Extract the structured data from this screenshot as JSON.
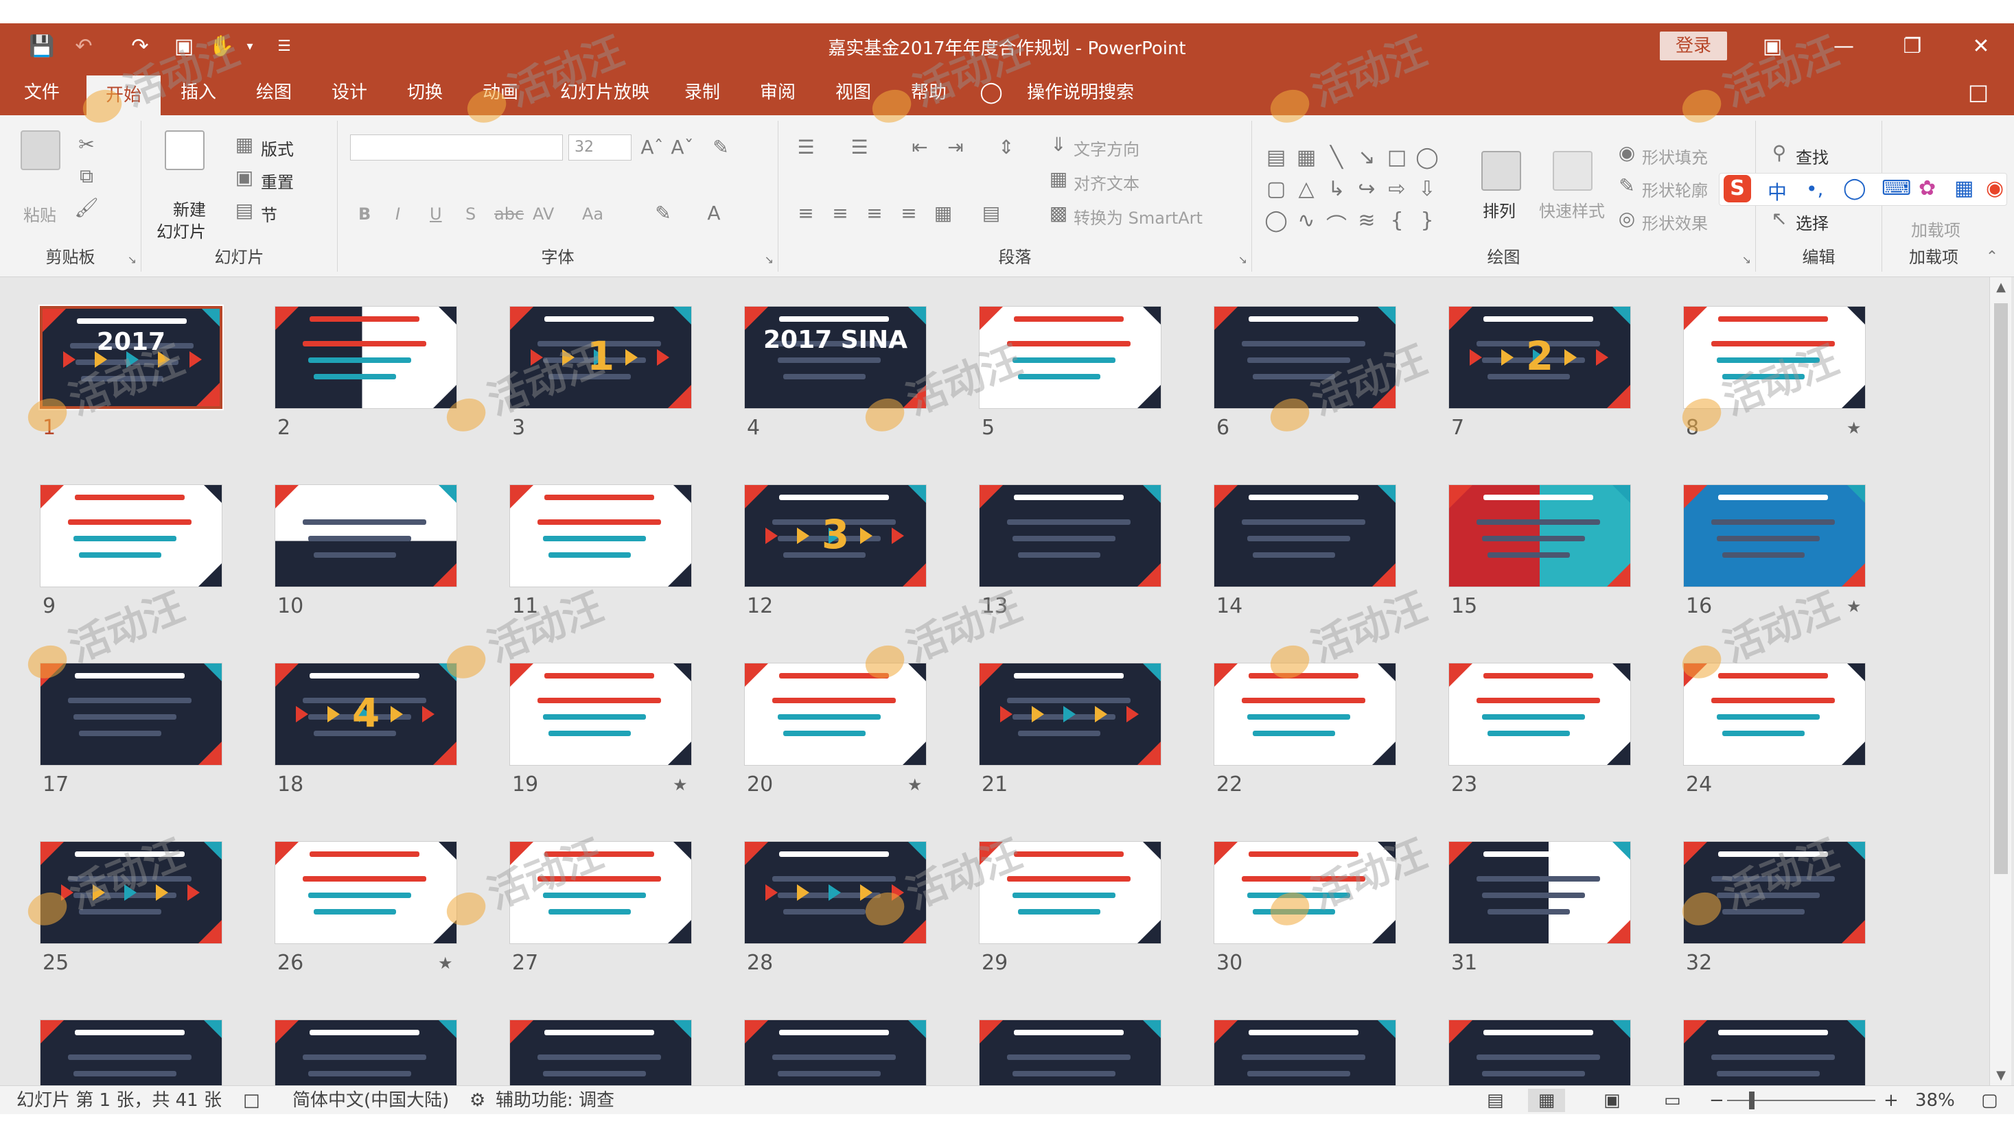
{
  "window": {
    "title": "嘉实基金2017年年度合作规划 - PowerPoint",
    "signin_label": "登录",
    "colors": {
      "accent": "#b7472a",
      "ribbon_bg": "#f3f3f3",
      "workspace_bg": "#e7e7e7"
    }
  },
  "quick_access": [
    "save-icon",
    "undo-icon",
    "redo-icon",
    "present-icon",
    "touch-mode-icon",
    "customize-icon"
  ],
  "tabs": [
    {
      "label": "文件"
    },
    {
      "label": "开始"
    },
    {
      "label": "插入"
    },
    {
      "label": "绘图"
    },
    {
      "label": "设计"
    },
    {
      "label": "切换"
    },
    {
      "label": "动画"
    },
    {
      "label": "幻灯片放映"
    },
    {
      "label": "录制"
    },
    {
      "label": "审阅"
    },
    {
      "label": "视图"
    },
    {
      "label": "帮助"
    }
  ],
  "tell_me": "操作说明搜索",
  "ribbon": {
    "clipboard": {
      "label": "剪贴板",
      "paste": "粘贴"
    },
    "slides": {
      "label": "幻灯片",
      "new_slide_1": "新建",
      "new_slide_2": "幻灯片",
      "layout": "版式",
      "reset": "重置",
      "section": "节"
    },
    "font": {
      "label": "字体",
      "size": "32",
      "bold": "B",
      "italic": "I",
      "underline": "U",
      "shadow": "S",
      "strike": "abc",
      "spacing": "AV",
      "case": "Aa"
    },
    "paragraph": {
      "label": "段落",
      "text_direction": "文字方向",
      "align_text": "对齐文本",
      "smartart": "转换为 SmartArt"
    },
    "drawing": {
      "label": "绘图",
      "arrange": "排列",
      "quick_styles": "快速样式",
      "fill": "形状填充",
      "outline": "形状轮廓",
      "effects": "形状效果"
    },
    "editing": {
      "label": "编辑",
      "find": "查找",
      "select": "选择"
    },
    "addins": {
      "label": "加载项",
      "addins": "加载项"
    }
  },
  "slides": [
    {
      "n": "1",
      "theme": "dark",
      "text": "2017",
      "starred": false,
      "selected": true
    },
    {
      "n": "2",
      "theme": "globe",
      "text": "",
      "starred": false,
      "selected": false
    },
    {
      "n": "3",
      "theme": "dark1",
      "text": "1",
      "starred": false,
      "selected": false
    },
    {
      "n": "4",
      "theme": "sina",
      "text": "2017 SINA",
      "starred": false,
      "selected": false
    },
    {
      "n": "5",
      "theme": "light",
      "text": "",
      "starred": false,
      "selected": false
    },
    {
      "n": "6",
      "theme": "dark",
      "text": "",
      "starred": false,
      "selected": false
    },
    {
      "n": "7",
      "theme": "dark2",
      "text": "2",
      "starred": false,
      "selected": false
    },
    {
      "n": "8",
      "theme": "light",
      "text": "",
      "starred": true,
      "selected": false
    },
    {
      "n": "9",
      "theme": "light",
      "text": "",
      "starred": false,
      "selected": false
    },
    {
      "n": "10",
      "theme": "teal",
      "text": "",
      "starred": false,
      "selected": false
    },
    {
      "n": "11",
      "theme": "light",
      "text": "",
      "starred": false,
      "selected": false
    },
    {
      "n": "12",
      "theme": "dark3",
      "text": "3",
      "starred": false,
      "selected": false
    },
    {
      "n": "13",
      "theme": "dark",
      "text": "",
      "starred": false,
      "selected": false
    },
    {
      "n": "14",
      "theme": "dark",
      "text": "",
      "starred": false,
      "selected": false
    },
    {
      "n": "15",
      "theme": "redcyan",
      "text": "",
      "starred": false,
      "selected": false
    },
    {
      "n": "16",
      "theme": "bluemap",
      "text": "",
      "starred": true,
      "selected": false
    },
    {
      "n": "17",
      "theme": "dark",
      "text": "",
      "starred": false,
      "selected": false
    },
    {
      "n": "18",
      "theme": "dark4",
      "text": "4",
      "starred": false,
      "selected": false
    },
    {
      "n": "19",
      "theme": "light",
      "text": "",
      "starred": true,
      "selected": false
    },
    {
      "n": "20",
      "theme": "light",
      "text": "",
      "starred": true,
      "selected": false
    },
    {
      "n": "21",
      "theme": "darkarrow",
      "text": "",
      "starred": false,
      "selected": false
    },
    {
      "n": "22",
      "theme": "light",
      "text": "",
      "starred": false,
      "selected": false
    },
    {
      "n": "23",
      "theme": "light",
      "text": "",
      "starred": false,
      "selected": false
    },
    {
      "n": "24",
      "theme": "light",
      "text": "",
      "starred": false,
      "selected": false
    },
    {
      "n": "25",
      "theme": "darkarrow",
      "text": "",
      "starred": false,
      "selected": false
    },
    {
      "n": "26",
      "theme": "light",
      "text": "",
      "starred": true,
      "selected": false
    },
    {
      "n": "27",
      "theme": "light",
      "text": "",
      "starred": false,
      "selected": false
    },
    {
      "n": "28",
      "theme": "darkarrow",
      "text": "",
      "starred": false,
      "selected": false
    },
    {
      "n": "29",
      "theme": "light",
      "text": "",
      "starred": false,
      "selected": false
    },
    {
      "n": "30",
      "theme": "light",
      "text": "",
      "starred": false,
      "selected": false
    },
    {
      "n": "31",
      "theme": "map",
      "text": "",
      "starred": false,
      "selected": false
    },
    {
      "n": "32",
      "theme": "dark",
      "text": "",
      "starred": false,
      "selected": false
    },
    {
      "n": "",
      "theme": "dark",
      "text": "",
      "starred": false,
      "selected": false
    },
    {
      "n": "",
      "theme": "dark",
      "text": "",
      "starred": false,
      "selected": false
    },
    {
      "n": "",
      "theme": "dark",
      "text": "",
      "starred": false,
      "selected": false
    },
    {
      "n": "",
      "theme": "dark",
      "text": "",
      "starred": false,
      "selected": false
    },
    {
      "n": "",
      "theme": "dark",
      "text": "",
      "starred": false,
      "selected": false
    },
    {
      "n": "",
      "theme": "dark",
      "text": "",
      "starred": false,
      "selected": false
    },
    {
      "n": "",
      "theme": "dark",
      "text": "",
      "starred": false,
      "selected": false
    },
    {
      "n": "",
      "theme": "dark",
      "text": "",
      "starred": false,
      "selected": false
    }
  ],
  "statusbar": {
    "slide_info": "幻灯片 第 1 张，共 41 张",
    "language": "简体中文(中国大陆)",
    "accessibility": "辅助功能: 调查",
    "zoom": "38%"
  },
  "watermark": "活动汪"
}
